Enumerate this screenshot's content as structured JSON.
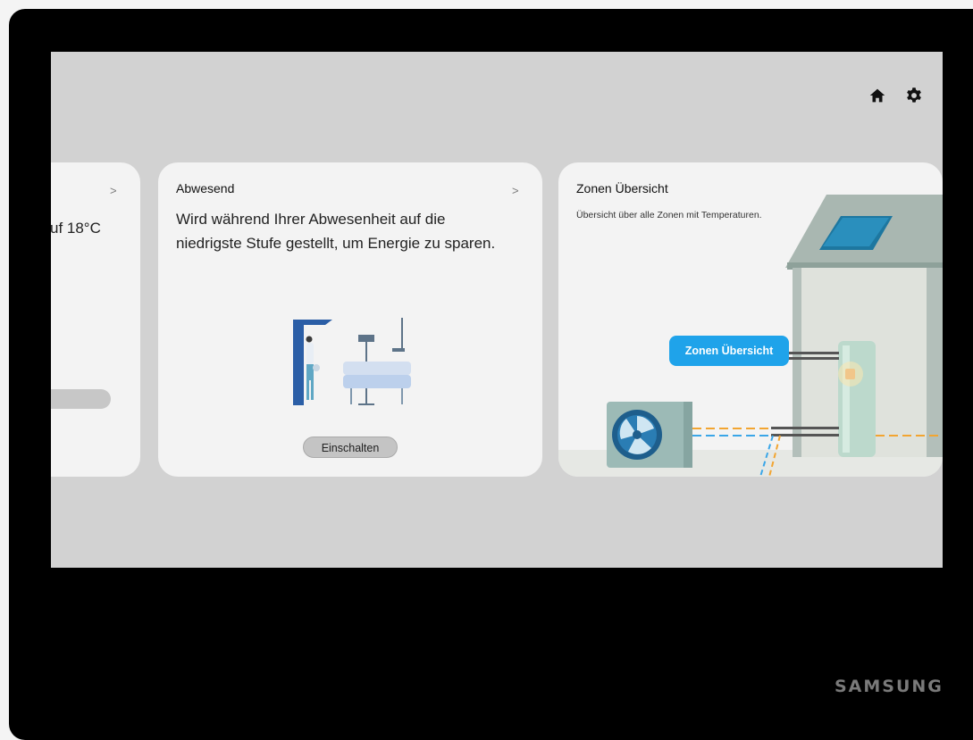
{
  "header": {
    "home_icon": "home-icon",
    "settings_icon": "gear-icon"
  },
  "cards": {
    "left": {
      "text_fragment": "uf 18°C",
      "chevron": ">"
    },
    "abwesend": {
      "title": "Abwesend",
      "chevron": ">",
      "description": "Wird während Ihrer Abwesenheit auf die niedrigste Stufe gestellt, um Energie zu sparen.",
      "button_label": "Einschalten"
    },
    "zonen": {
      "title": "Zonen Übersicht",
      "subtitle": "Übersicht über alle Zonen mit Temperaturen.",
      "button_label": "Zonen Übersicht"
    }
  },
  "brand": "SAMSUNG",
  "colors": {
    "accent": "#1fa3ea",
    "screen_bg": "#d2d2d2",
    "card_bg": "#f3f3f3"
  }
}
